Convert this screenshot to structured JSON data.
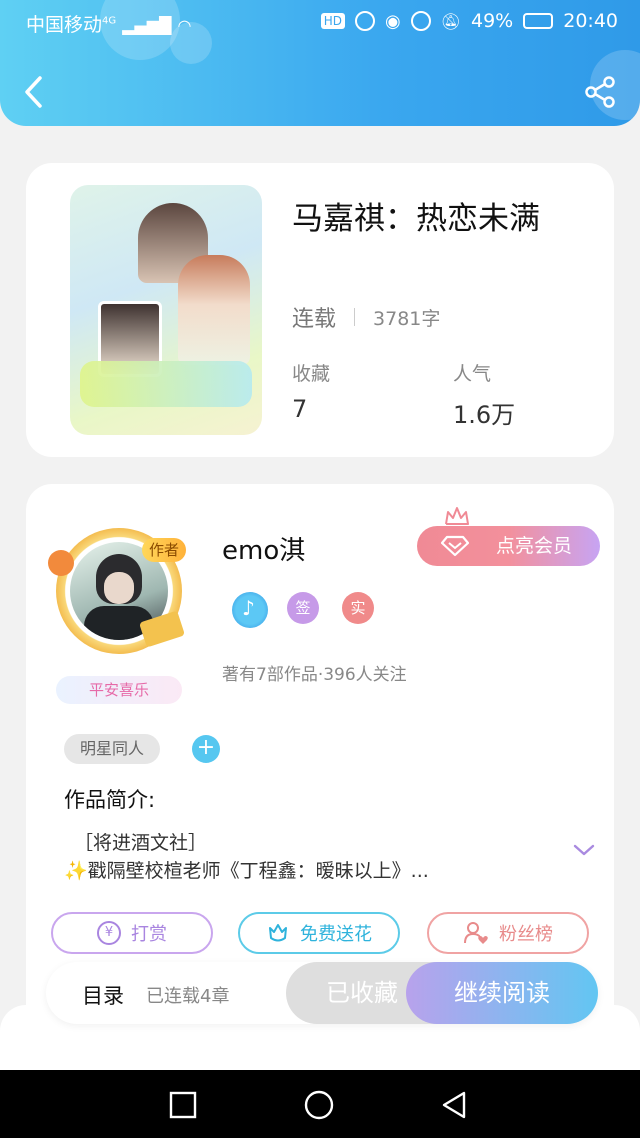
{
  "status_bar": {
    "carrier": "中国移动",
    "network": "4G",
    "battery": "49%",
    "time": "20:40"
  },
  "book": {
    "title": "马嘉祺：热恋未满",
    "status": "连载",
    "word_count": "3781字",
    "favorites_label": "收藏",
    "favorites_value": "7",
    "popularity_label": "人气",
    "popularity_value": "1.6万"
  },
  "author": {
    "badge": "作者",
    "name": "emo淇",
    "name_badge": "平安喜乐",
    "vip_button": "点亮会员",
    "medals": [
      "签",
      "实"
    ],
    "stats": "著有7部作品·396人关注",
    "tag": "明星同人",
    "tag_add": "+"
  },
  "intro": {
    "heading": "作品简介:",
    "line1": "［将进酒文社］",
    "line2": "✨戳隔壁校楦老师《丁程鑫：暧昧以上》..."
  },
  "actions": {
    "tip": "打赏",
    "flower": "免费送花",
    "fans": "粉丝榜"
  },
  "bottom": {
    "toc": "目录",
    "chapters": "已连载4章",
    "collected": "已收藏",
    "continue": "继续阅读"
  },
  "colors": {
    "header_start": "#5fd0f3",
    "header_end": "#2f9ae8",
    "tip_border": "#c9a6ee",
    "flower_border": "#5ccbe8",
    "fans_border": "#f0a3a3"
  }
}
